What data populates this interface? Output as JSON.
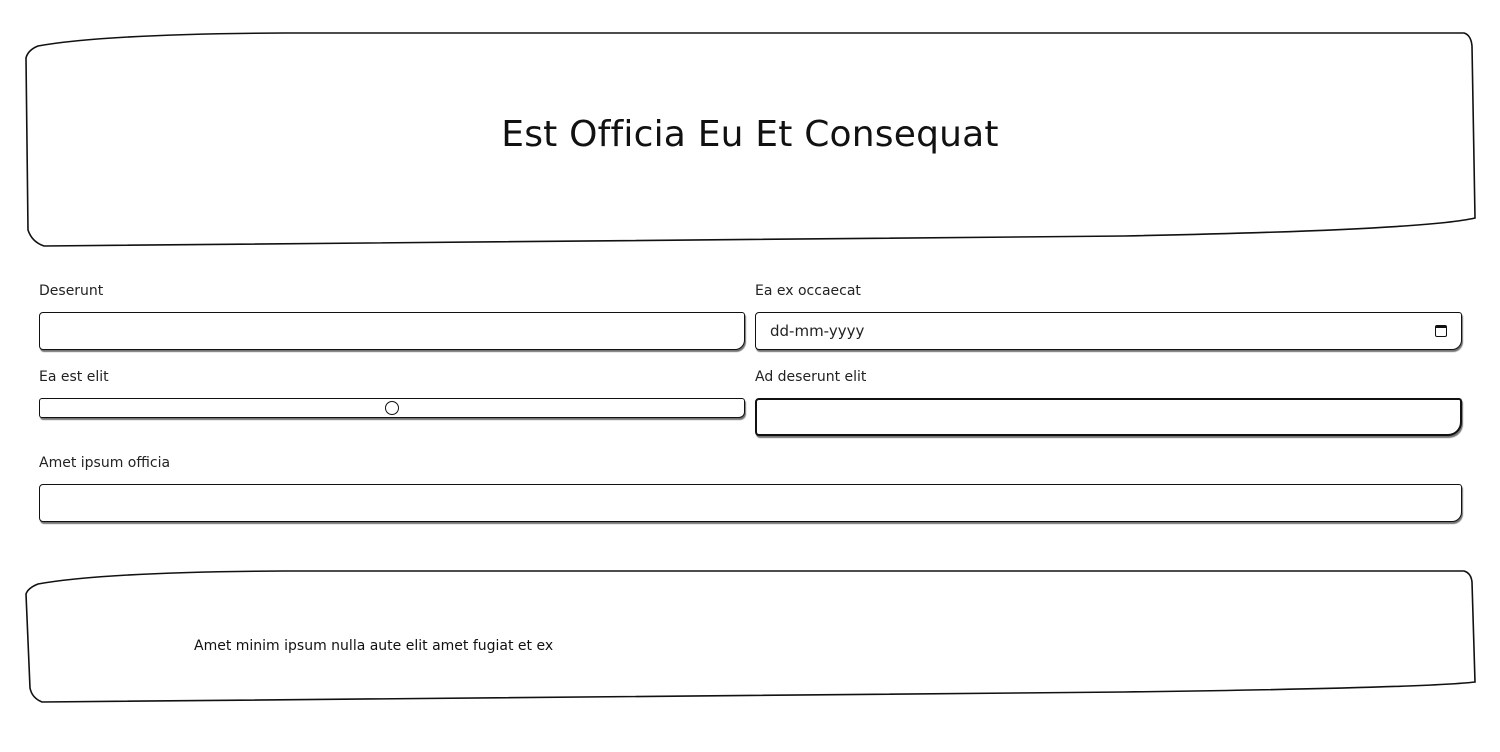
{
  "header": {
    "title": "Est Officia Eu Et Consequat"
  },
  "form": {
    "deserunt": {
      "label": "Deserunt",
      "value": ""
    },
    "ea_ex_occaecat": {
      "label": "Ea ex occaecat",
      "placeholder": "dd-mm-yyyy",
      "icon": "calendar-icon"
    },
    "ea_est_elit": {
      "label": "Ea est elit",
      "value_fraction": 0.5
    },
    "ad_deserunt_elit": {
      "label": "Ad deserunt elit",
      "value": ""
    },
    "amet_ipsum_officia": {
      "label": "Amet ipsum officia",
      "value": ""
    }
  },
  "footer": {
    "text": "Amet minim ipsum nulla aute elit amet fugiat et ex"
  }
}
